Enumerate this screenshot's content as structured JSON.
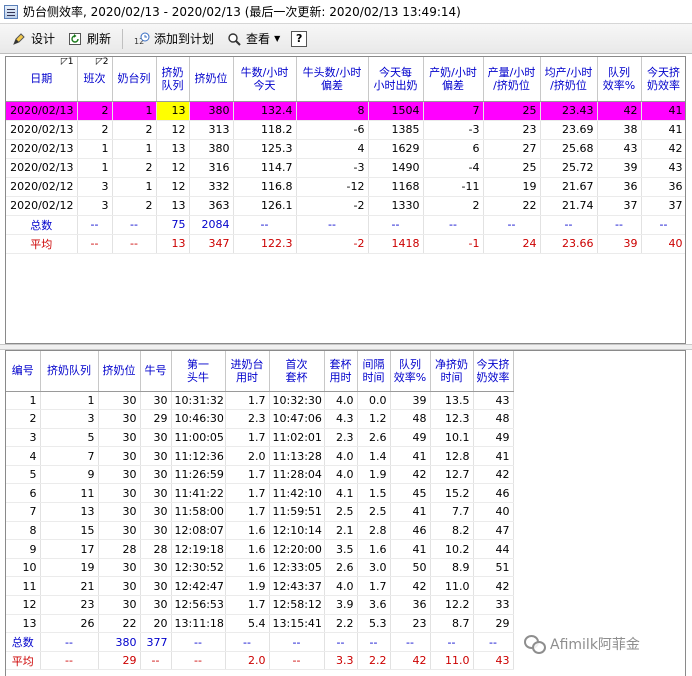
{
  "window": {
    "title": "奶台侧效率, 2020/02/13 - 2020/02/13 (最后一次更新: 2020/02/13 13:49:14)"
  },
  "toolbar": {
    "design": "设计",
    "refresh": "刷新",
    "add_to_plan": "添加到计划",
    "view": "查看",
    "help": "?"
  },
  "top_table": {
    "sort_marks": [
      "1",
      "2"
    ],
    "headers": [
      [
        "日期"
      ],
      [
        "班次"
      ],
      [
        "奶台列"
      ],
      [
        "挤奶",
        "队列"
      ],
      [
        "挤奶位"
      ],
      [
        "牛数/小时",
        "今天"
      ],
      [
        "牛头数/小时",
        "偏差"
      ],
      [
        "今天每",
        "小时出奶"
      ],
      [
        "产奶/小时",
        "偏差"
      ],
      [
        "产量/小时",
        "/挤奶位"
      ],
      [
        "均产/小时",
        "/挤奶位"
      ],
      [
        "队列",
        "效率%"
      ],
      [
        "今天挤",
        "奶效率"
      ]
    ],
    "rows": [
      [
        "2020/02/13",
        "2",
        "1",
        "13",
        "380",
        "132.4",
        "8",
        "1504",
        "7",
        "25",
        "23.43",
        "42",
        "41"
      ],
      [
        "2020/02/13",
        "2",
        "2",
        "12",
        "313",
        "118.2",
        "-6",
        "1385",
        "-3",
        "23",
        "23.69",
        "38",
        "41"
      ],
      [
        "2020/02/13",
        "1",
        "1",
        "13",
        "380",
        "125.3",
        "4",
        "1629",
        "6",
        "27",
        "25.68",
        "43",
        "42"
      ],
      [
        "2020/02/13",
        "1",
        "2",
        "12",
        "316",
        "114.7",
        "-3",
        "1490",
        "-4",
        "25",
        "25.72",
        "39",
        "43"
      ],
      [
        "2020/02/12",
        "3",
        "1",
        "12",
        "332",
        "116.8",
        "-12",
        "1168",
        "-11",
        "19",
        "21.67",
        "36",
        "36"
      ],
      [
        "2020/02/12",
        "3",
        "2",
        "13",
        "363",
        "126.1",
        "-2",
        "1330",
        "2",
        "22",
        "21.74",
        "37",
        "37"
      ]
    ],
    "total": [
      "总数",
      "--",
      "--",
      "75",
      "2084",
      "--",
      "--",
      "--",
      "--",
      "--",
      "--",
      "--",
      "--"
    ],
    "average": [
      "平均",
      "--",
      "--",
      "13",
      "347",
      "122.3",
      "-2",
      "1418",
      "-1",
      "24",
      "23.66",
      "39",
      "40"
    ]
  },
  "bottom_table": {
    "headers": [
      [
        "编号"
      ],
      [
        "挤奶队列"
      ],
      [
        "挤奶位"
      ],
      [
        "牛号"
      ],
      [
        "第一",
        "头牛"
      ],
      [
        "进奶台",
        "用时"
      ],
      [
        "首次",
        "套杯"
      ],
      [
        "套杯",
        "用时"
      ],
      [
        "间隔",
        "时间"
      ],
      [
        "队列",
        "效率%"
      ],
      [
        "净挤奶",
        "时间"
      ],
      [
        "今天挤",
        "奶效率"
      ]
    ],
    "rows": [
      [
        "1",
        "1",
        "30",
        "30",
        "10:31:32",
        "1.7",
        "10:32:30",
        "4.0",
        "0.0",
        "39",
        "13.5",
        "43"
      ],
      [
        "2",
        "3",
        "30",
        "29",
        "10:46:30",
        "2.3",
        "10:47:06",
        "4.3",
        "1.2",
        "48",
        "12.3",
        "48"
      ],
      [
        "3",
        "5",
        "30",
        "30",
        "11:00:05",
        "1.7",
        "11:02:01",
        "2.3",
        "2.6",
        "49",
        "10.1",
        "49"
      ],
      [
        "4",
        "7",
        "30",
        "30",
        "11:12:36",
        "2.0",
        "11:13:28",
        "4.0",
        "1.4",
        "41",
        "12.8",
        "41"
      ],
      [
        "5",
        "9",
        "30",
        "30",
        "11:26:59",
        "1.7",
        "11:28:04",
        "4.0",
        "1.9",
        "42",
        "12.7",
        "42"
      ],
      [
        "6",
        "11",
        "30",
        "30",
        "11:41:22",
        "1.7",
        "11:42:10",
        "4.1",
        "1.5",
        "45",
        "15.2",
        "46"
      ],
      [
        "7",
        "13",
        "30",
        "30",
        "11:58:00",
        "1.7",
        "11:59:51",
        "2.5",
        "2.5",
        "41",
        "7.7",
        "40"
      ],
      [
        "8",
        "15",
        "30",
        "30",
        "12:08:07",
        "1.6",
        "12:10:14",
        "2.1",
        "2.8",
        "46",
        "8.2",
        "47"
      ],
      [
        "9",
        "17",
        "28",
        "28",
        "12:19:18",
        "1.6",
        "12:20:00",
        "3.5",
        "1.6",
        "41",
        "10.2",
        "44"
      ],
      [
        "10",
        "19",
        "30",
        "30",
        "12:30:52",
        "1.6",
        "12:33:05",
        "2.6",
        "3.0",
        "50",
        "8.9",
        "51"
      ],
      [
        "11",
        "21",
        "30",
        "30",
        "12:42:47",
        "1.9",
        "12:43:37",
        "4.0",
        "1.7",
        "42",
        "11.0",
        "42"
      ],
      [
        "12",
        "23",
        "30",
        "30",
        "12:56:53",
        "1.7",
        "12:58:12",
        "3.9",
        "3.6",
        "36",
        "12.2",
        "33"
      ],
      [
        "13",
        "26",
        "22",
        "20",
        "13:11:18",
        "5.4",
        "13:15:41",
        "2.2",
        "5.3",
        "23",
        "8.7",
        "29"
      ]
    ],
    "total": [
      "总数",
      "--",
      "380",
      "377",
      "--",
      "--",
      "--",
      "--",
      "--",
      "--",
      "--",
      "--"
    ],
    "average": [
      "平均",
      "--",
      "29",
      "--",
      "--",
      "2.0",
      "--",
      "3.3",
      "2.2",
      "42",
      "11.0",
      "43"
    ]
  },
  "watermark": {
    "text": "Afimilk阿菲金"
  },
  "colors": {
    "highlight_row": "#ff00ff",
    "highlight_cell": "#ffff00",
    "header_text": "#0000cc",
    "average_text": "#cc0000"
  }
}
